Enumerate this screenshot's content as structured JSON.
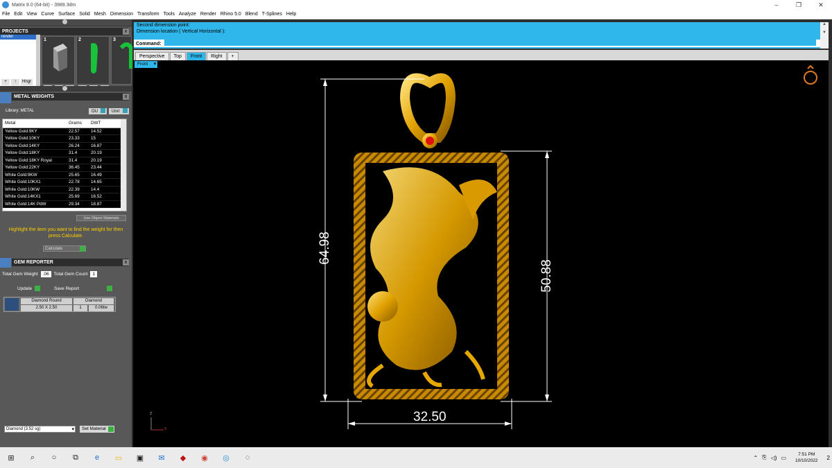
{
  "window": {
    "title": "Matrix 8.0 (64-bit) - 3989.3dm",
    "min": "–",
    "max": "❐",
    "close": "✕"
  },
  "menu": [
    "File",
    "Edit",
    "View",
    "Curve",
    "Surface",
    "Solid",
    "Mesh",
    "Dimension",
    "Transform",
    "Tools",
    "Analyze",
    "Render",
    "Rhino 5.0",
    "Blend",
    "T-Splines",
    "Help"
  ],
  "projects": {
    "title": "PROJECTS",
    "list_item": "render",
    "thumb_nums": [
      "1",
      "2",
      "3"
    ],
    "tools": [
      "+",
      "↑",
      "Hngr"
    ]
  },
  "metal_weights": {
    "title": "METAL WEIGHTS",
    "library": "Library: METAL",
    "btn1": "OU",
    "btn2": "Unrr",
    "columns": [
      "Metal",
      "Grams",
      "DWT"
    ],
    "rows": [
      [
        "Yellow Gold:9KY",
        "22.57",
        "14.52"
      ],
      [
        "Yellow Gold:10KY",
        "23.33",
        "15"
      ],
      [
        "Yellow Gold:14KY",
        "26.24",
        "16.87"
      ],
      [
        "Yellow Gold:18KY",
        "31.4",
        "20.19"
      ],
      [
        "Yellow Gold:18KY Royal",
        "31.4",
        "20.19"
      ],
      [
        "Yellow Gold:22KY",
        "36.45",
        "23.44"
      ],
      [
        "White Gold:9KW",
        "25.65",
        "16.49"
      ],
      [
        "White Gold:10KX1",
        "22.78",
        "14.65"
      ],
      [
        "White Gold:10KW",
        "22.39",
        "14.4"
      ],
      [
        "White Gold:14KX1",
        "25.69",
        "16.52"
      ],
      [
        "White Gold:14K PdW",
        "29.34",
        "18.87"
      ]
    ],
    "use_object": "Use Object Materials",
    "highlight": "Highlight the item you want to find the weight for then press Calculate.",
    "calculate": "Calculate"
  },
  "gem_reporter": {
    "title": "GEM REPORTER",
    "total_weight_label": "Total Gem Weight",
    "total_weight": ".06",
    "total_count_label": "Total Gem Count",
    "total_count": "1",
    "update": "Update",
    "save_report": "Save Report",
    "gem_name": "Diamond Round",
    "gem_size": "2.50 X 2.50",
    "gem_material": "Diamond",
    "gem_qty": "1",
    "gem_weight": "0.06tw"
  },
  "material": {
    "select": "Diamond    (3.52 sg)",
    "set_button": "Set Material"
  },
  "command": {
    "line1": "Second dimension point:",
    "line2": "Dimension location ( Vertical  Horizontal ):",
    "label": "Command:"
  },
  "view_tabs": [
    "Perspective",
    "Top",
    "Front",
    "Right",
    "+"
  ],
  "viewport": {
    "label": "Front",
    "axis_z": "z",
    "axis_x": "x"
  },
  "dimensions": {
    "height_total": "64.98",
    "height_frame": "50.88",
    "width": "32.50"
  },
  "taskbar": {
    "time": "7:51 PM",
    "date": "10/10/2022",
    "notif": "2"
  }
}
